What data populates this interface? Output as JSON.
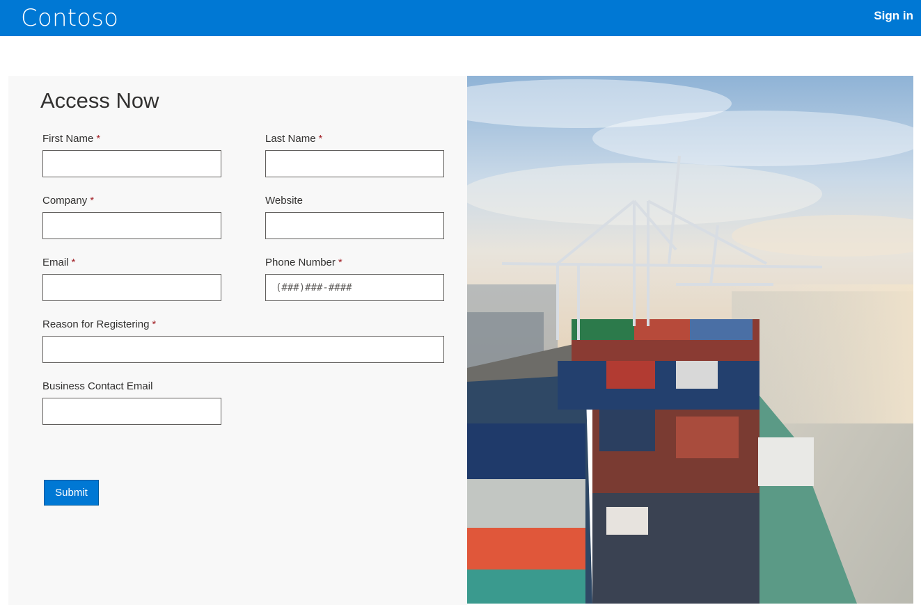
{
  "header": {
    "brand": "Contoso",
    "sign_in_label": "Sign in",
    "bar_color": "#0078d4"
  },
  "form": {
    "title": "Access Now",
    "required_marker": "*",
    "fields": {
      "first_name": {
        "label": "First Name",
        "required": true,
        "value": "",
        "placeholder": ""
      },
      "last_name": {
        "label": "Last Name",
        "required": true,
        "value": "",
        "placeholder": ""
      },
      "company": {
        "label": "Company",
        "required": true,
        "value": "",
        "placeholder": ""
      },
      "website": {
        "label": "Website",
        "required": false,
        "value": "",
        "placeholder": ""
      },
      "email": {
        "label": "Email",
        "required": true,
        "value": "",
        "placeholder": ""
      },
      "phone": {
        "label": "Phone Number",
        "required": true,
        "value": "",
        "placeholder": "(###)###-####"
      },
      "reason": {
        "label": "Reason for Registering",
        "required": true,
        "value": "",
        "placeholder": ""
      },
      "business_email": {
        "label": "Business Contact Email",
        "required": false,
        "value": "",
        "placeholder": ""
      }
    },
    "submit_label": "Submit",
    "submit_color": "#0078d4",
    "required_color": "#a4262c"
  },
  "hero": {
    "image_subject": "container-ship-port-image"
  }
}
